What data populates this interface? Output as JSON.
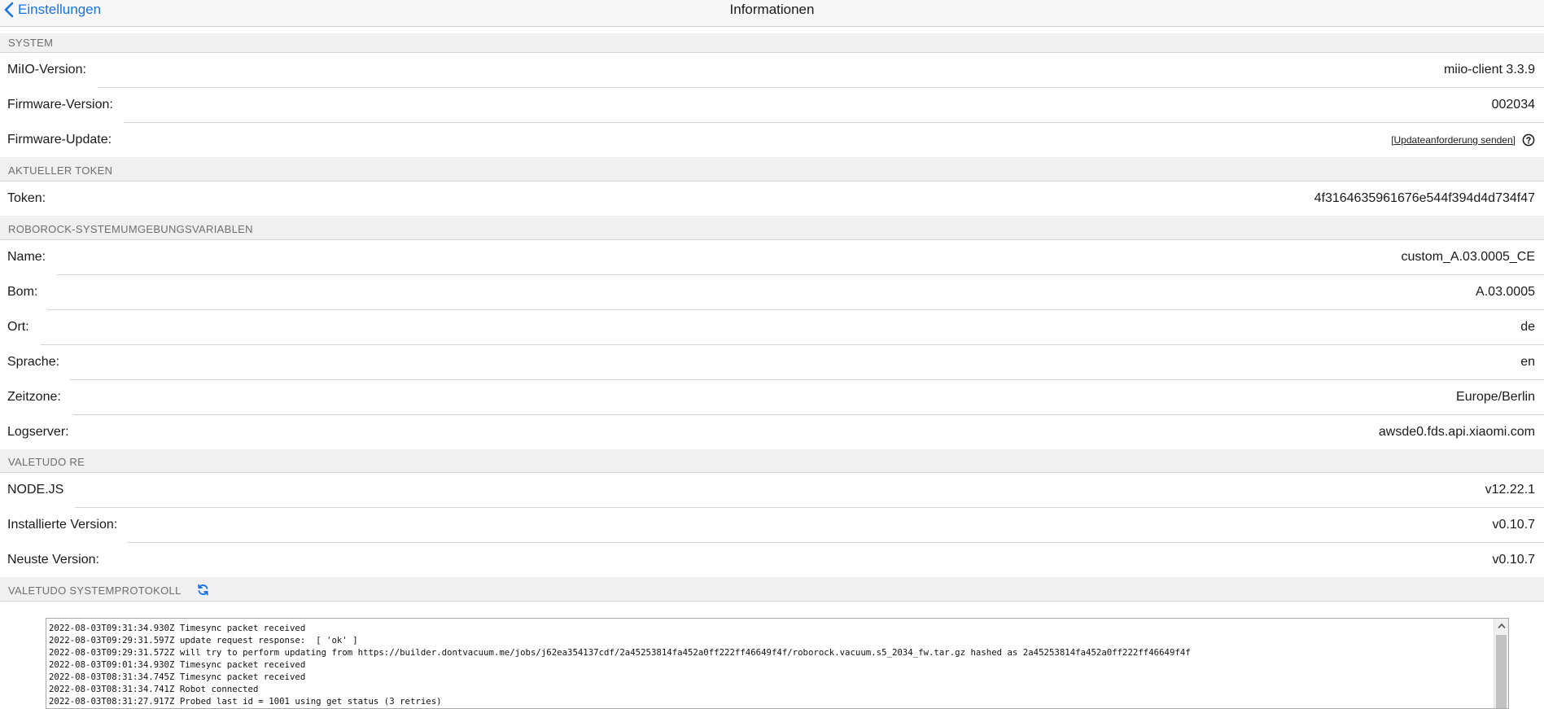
{
  "nav": {
    "back_label": "Einstellungen",
    "title": "Informationen"
  },
  "sections": {
    "system": "SYSTEM",
    "token": "AKTUELLER TOKEN",
    "env": "ROBOROCK-SYSTEMUMGEBUNGSVARIABLEN",
    "valetudo": "VALETUDO RE",
    "log": "VALETUDO SYSTEMPROTOKOLL"
  },
  "system": {
    "miio_label": "MiIO-Version:",
    "miio_value": "miio-client 3.3.9",
    "fw_label": "Firmware-Version:",
    "fw_value": "002034",
    "fwupdate_label": "Firmware-Update:",
    "fwupdate_link": "[Updateanforderung senden]"
  },
  "token": {
    "label": "Token:",
    "value": "4f3164635961676e544f394d4d734f47"
  },
  "env": {
    "name_label": "Name:",
    "name_value": "custom_A.03.0005_CE",
    "bom_label": "Bom:",
    "bom_value": "A.03.0005",
    "ort_label": "Ort:",
    "ort_value": "de",
    "sprache_label": "Sprache:",
    "sprache_value": "en",
    "zeitzone_label": "Zeitzone:",
    "zeitzone_value": "Europe/Berlin",
    "logserver_label": "Logserver:",
    "logserver_value": "awsde0.fds.api.xiaomi.com"
  },
  "valetudo": {
    "node_label": "NODE.JS",
    "node_value": "v12.22.1",
    "installed_label": "Installierte Version:",
    "installed_value": "v0.10.7",
    "latest_label": "Neuste Version:",
    "latest_value": "v0.10.7"
  },
  "log": {
    "lines": [
      "2022-08-03T09:31:34.930Z Timesync packet received",
      "2022-08-03T09:29:31.597Z update request response:  [ 'ok' ]",
      "2022-08-03T09:29:31.572Z will try to perform updating from https://builder.dontvacuum.me/jobs/j62ea354137cdf/2a45253814fa452a0ff222ff46649f4f/roborock.vacuum.s5_2034_fw.tar.gz hashed as 2a45253814fa452a0ff222ff46649f4f",
      "2022-08-03T09:01:34.930Z Timesync packet received",
      "2022-08-03T08:31:34.745Z Timesync packet received",
      "2022-08-03T08:31:34.741Z Robot connected",
      "2022-08-03T08:31:27.917Z Probed last id = 1001 using get status (3 retries)"
    ]
  },
  "icons": {
    "back": "chevron-left-icon",
    "help": "question-circle-icon",
    "refresh": "refresh-icon"
  },
  "colors": {
    "accent": "#1a73e8",
    "section_bg": "#f0f0f2"
  }
}
